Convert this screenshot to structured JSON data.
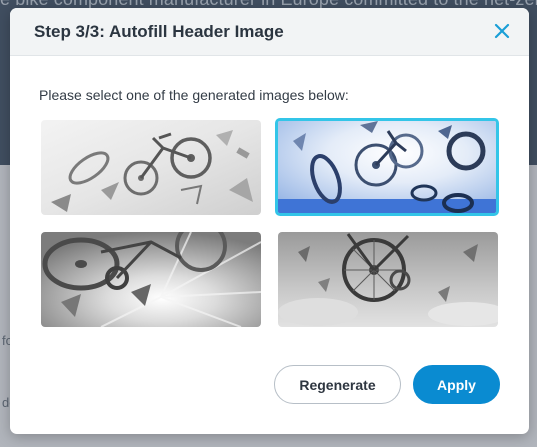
{
  "background": {
    "header_text": "e bike component manufacturer in Europe committed to the net-zero sta",
    "fragment_1": "fo",
    "fragment_2": "de"
  },
  "dialog": {
    "title": "Step 3/3: Autofill Header Image",
    "close_icon": "close-icon",
    "prompt": "Please select one of the generated images below:",
    "images": [
      {
        "id": "generated-image-1",
        "description_icon": "bicycle-parts-grayscale",
        "selected": false
      },
      {
        "id": "generated-image-2",
        "description_icon": "bicycle-parts-blue",
        "selected": true
      },
      {
        "id": "generated-image-3",
        "description_icon": "bicycle-wheels-grayscale",
        "selected": false
      },
      {
        "id": "generated-image-4",
        "description_icon": "bicycle-wheel-sky-grayscale",
        "selected": false
      }
    ],
    "buttons": {
      "regenerate": "Regenerate",
      "apply": "Apply"
    }
  },
  "colors": {
    "accent": "#0a8bd1",
    "selection": "#33c5e8",
    "close_icon": "#1a9fd6"
  }
}
